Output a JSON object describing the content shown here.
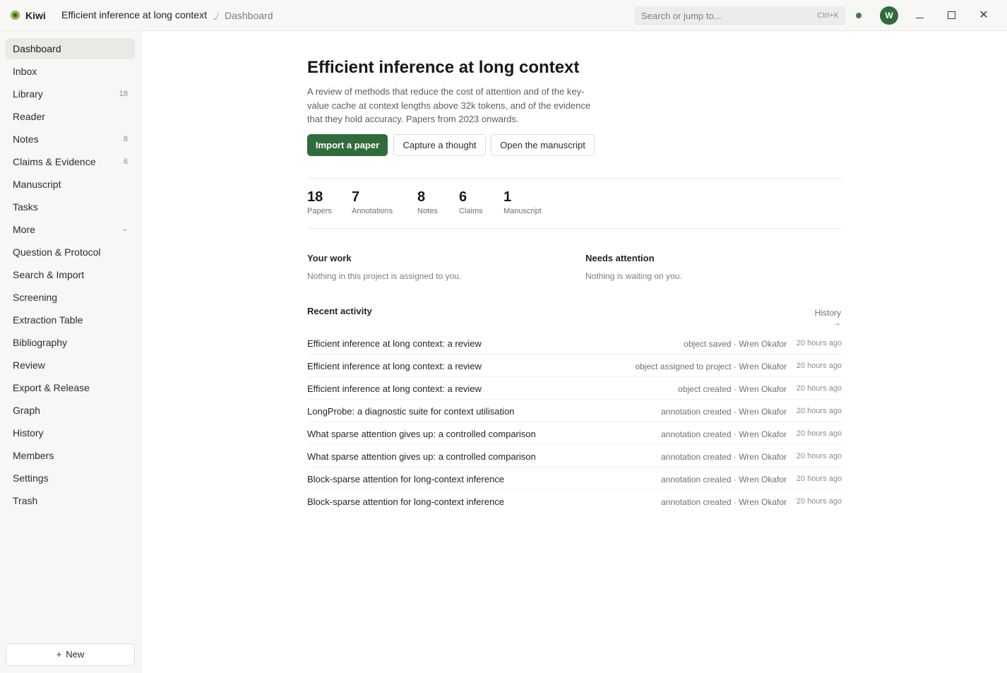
{
  "titlebar": {
    "app_name": "Kiwi",
    "project_name": "Efficient inference at long context",
    "breadcrumb_current": "Dashboard",
    "search_placeholder": "Search or jump to...",
    "search_shortcut": "Ctrl+K",
    "avatar_initial": "W"
  },
  "sidebar": {
    "items": [
      {
        "label": "Dashboard",
        "count": "",
        "active": true
      },
      {
        "label": "Inbox",
        "count": ""
      },
      {
        "label": "Library",
        "count": "18"
      },
      {
        "label": "Reader",
        "count": ""
      },
      {
        "label": "Notes",
        "count": "8"
      },
      {
        "label": "Claims & Evidence",
        "count": "6"
      },
      {
        "label": "Manuscript",
        "count": ""
      },
      {
        "label": "Tasks",
        "count": ""
      },
      {
        "label": "More",
        "count": ""
      },
      {
        "label": "Question & Protocol",
        "count": ""
      },
      {
        "label": "Search & Import",
        "count": ""
      },
      {
        "label": "Screening",
        "count": ""
      },
      {
        "label": "Extraction Table",
        "count": ""
      },
      {
        "label": "Bibliography",
        "count": ""
      },
      {
        "label": "Review",
        "count": ""
      },
      {
        "label": "Export & Release",
        "count": ""
      },
      {
        "label": "Graph",
        "count": ""
      },
      {
        "label": "History",
        "count": ""
      },
      {
        "label": "Members",
        "count": ""
      },
      {
        "label": "Settings",
        "count": ""
      },
      {
        "label": "Trash",
        "count": ""
      }
    ],
    "new_button": "New"
  },
  "main": {
    "title": "Efficient inference at long context",
    "description": "A review of methods that reduce the cost of attention and of the key-value cache at context lengths above 32k tokens, and of the evidence that they hold accuracy. Papers from 2023 onwards.",
    "actions": {
      "import": "Import a paper",
      "capture": "Capture a thought",
      "open_manuscript": "Open the manuscript"
    },
    "stats": [
      {
        "value": "18",
        "label": "Papers"
      },
      {
        "value": "7",
        "label": "Annotations"
      },
      {
        "value": "8",
        "label": "Notes"
      },
      {
        "value": "6",
        "label": "Claims"
      },
      {
        "value": "1",
        "label": "Manuscript"
      }
    ],
    "your_work": {
      "title": "Your work",
      "text": "Nothing in this project is assigned to you."
    },
    "needs_attention": {
      "title": "Needs attention",
      "text": "Nothing is waiting on you."
    },
    "recent_activity": {
      "title": "Recent activity",
      "history_link": "History →",
      "rows": [
        {
          "title": "Efficient inference at long context: a review",
          "meta": "object saved · Wren Okafor",
          "time": "20 hours ago"
        },
        {
          "title": "Efficient inference at long context: a review",
          "meta": "object assigned to project · Wren Okafor",
          "time": "20 hours ago"
        },
        {
          "title": "Efficient inference at long context: a review",
          "meta": "object created · Wren Okafor",
          "time": "20 hours ago"
        },
        {
          "title": "LongProbe: a diagnostic suite for context utilisation",
          "meta": "annotation created · Wren Okafor",
          "time": "20 hours ago"
        },
        {
          "title": "What sparse attention gives up: a controlled comparison",
          "meta": "annotation created · Wren Okafor",
          "time": "20 hours ago"
        },
        {
          "title": "What sparse attention gives up: a controlled comparison",
          "meta": "annotation created · Wren Okafor",
          "time": "20 hours ago"
        },
        {
          "title": "Block-sparse attention for long-context inference",
          "meta": "annotation created · Wren Okafor",
          "time": "20 hours ago"
        },
        {
          "title": "Block-sparse attention for long-context inference",
          "meta": "annotation created · Wren Okafor",
          "time": "20 hours ago"
        }
      ]
    }
  },
  "colors": {
    "accent": "#2f6b3b",
    "sidebar_bg": "#f7f7f5",
    "status_dot": "#3e7a4a"
  },
  "icons": {
    "logo": "kiwi-logo-icon",
    "switcher": "chevron-down-icon",
    "minimize": "minimize-icon",
    "maximize": "maximize-icon",
    "close": "close-icon",
    "new": "plus-icon"
  }
}
